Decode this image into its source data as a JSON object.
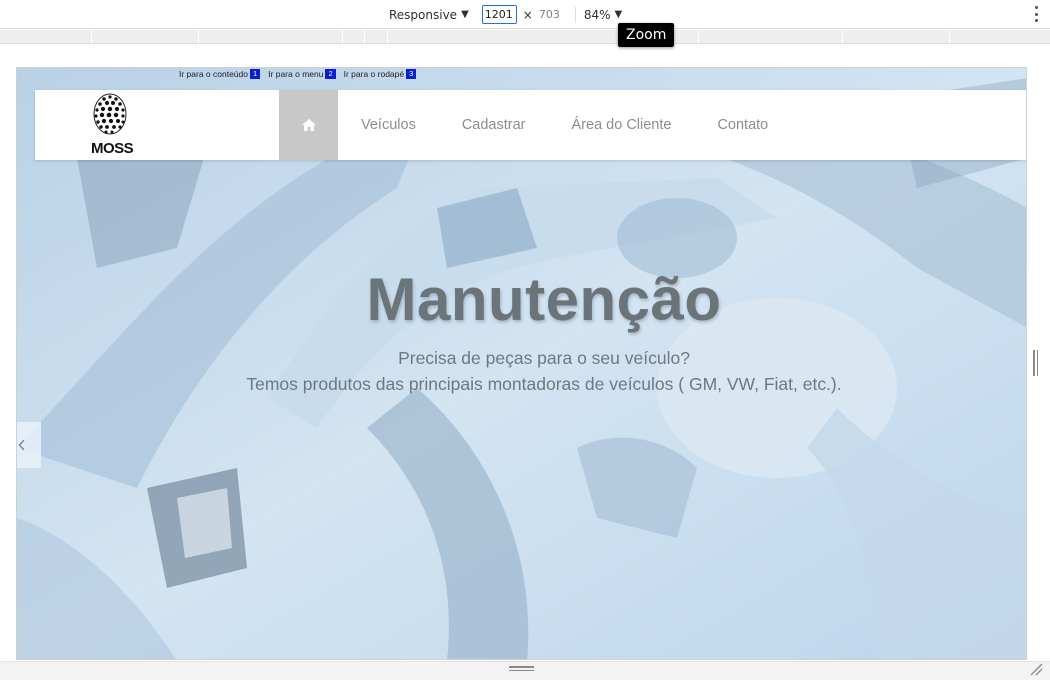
{
  "devtools": {
    "device_mode": "Responsive",
    "width_value": "1201",
    "times_sign": "×",
    "height_value": "703",
    "zoom": "84%",
    "tooltip": "Zoom"
  },
  "site": {
    "skip_links": [
      {
        "label": "Ir para o conteúdo",
        "num": "1"
      },
      {
        "label": "Ir para o menu",
        "num": "2"
      },
      {
        "label": "Ir para o rodapé",
        "num": "3"
      }
    ],
    "logo_text": "MOSS",
    "nav": [
      {
        "label": "Veículos"
      },
      {
        "label": "Cadastrar"
      },
      {
        "label": "Área do Cliente"
      },
      {
        "label": "Contato"
      }
    ],
    "hero": {
      "title": "Manutenção",
      "line1": "Precisa de peças para o seu veículo?",
      "line2": "Temos produtos das principais montadoras de veículos ( GM, VW, Fiat, etc.)."
    }
  },
  "icons": {
    "home": "home-icon",
    "prev": "chevron-left-icon",
    "menu": "kebab-menu-icon"
  }
}
